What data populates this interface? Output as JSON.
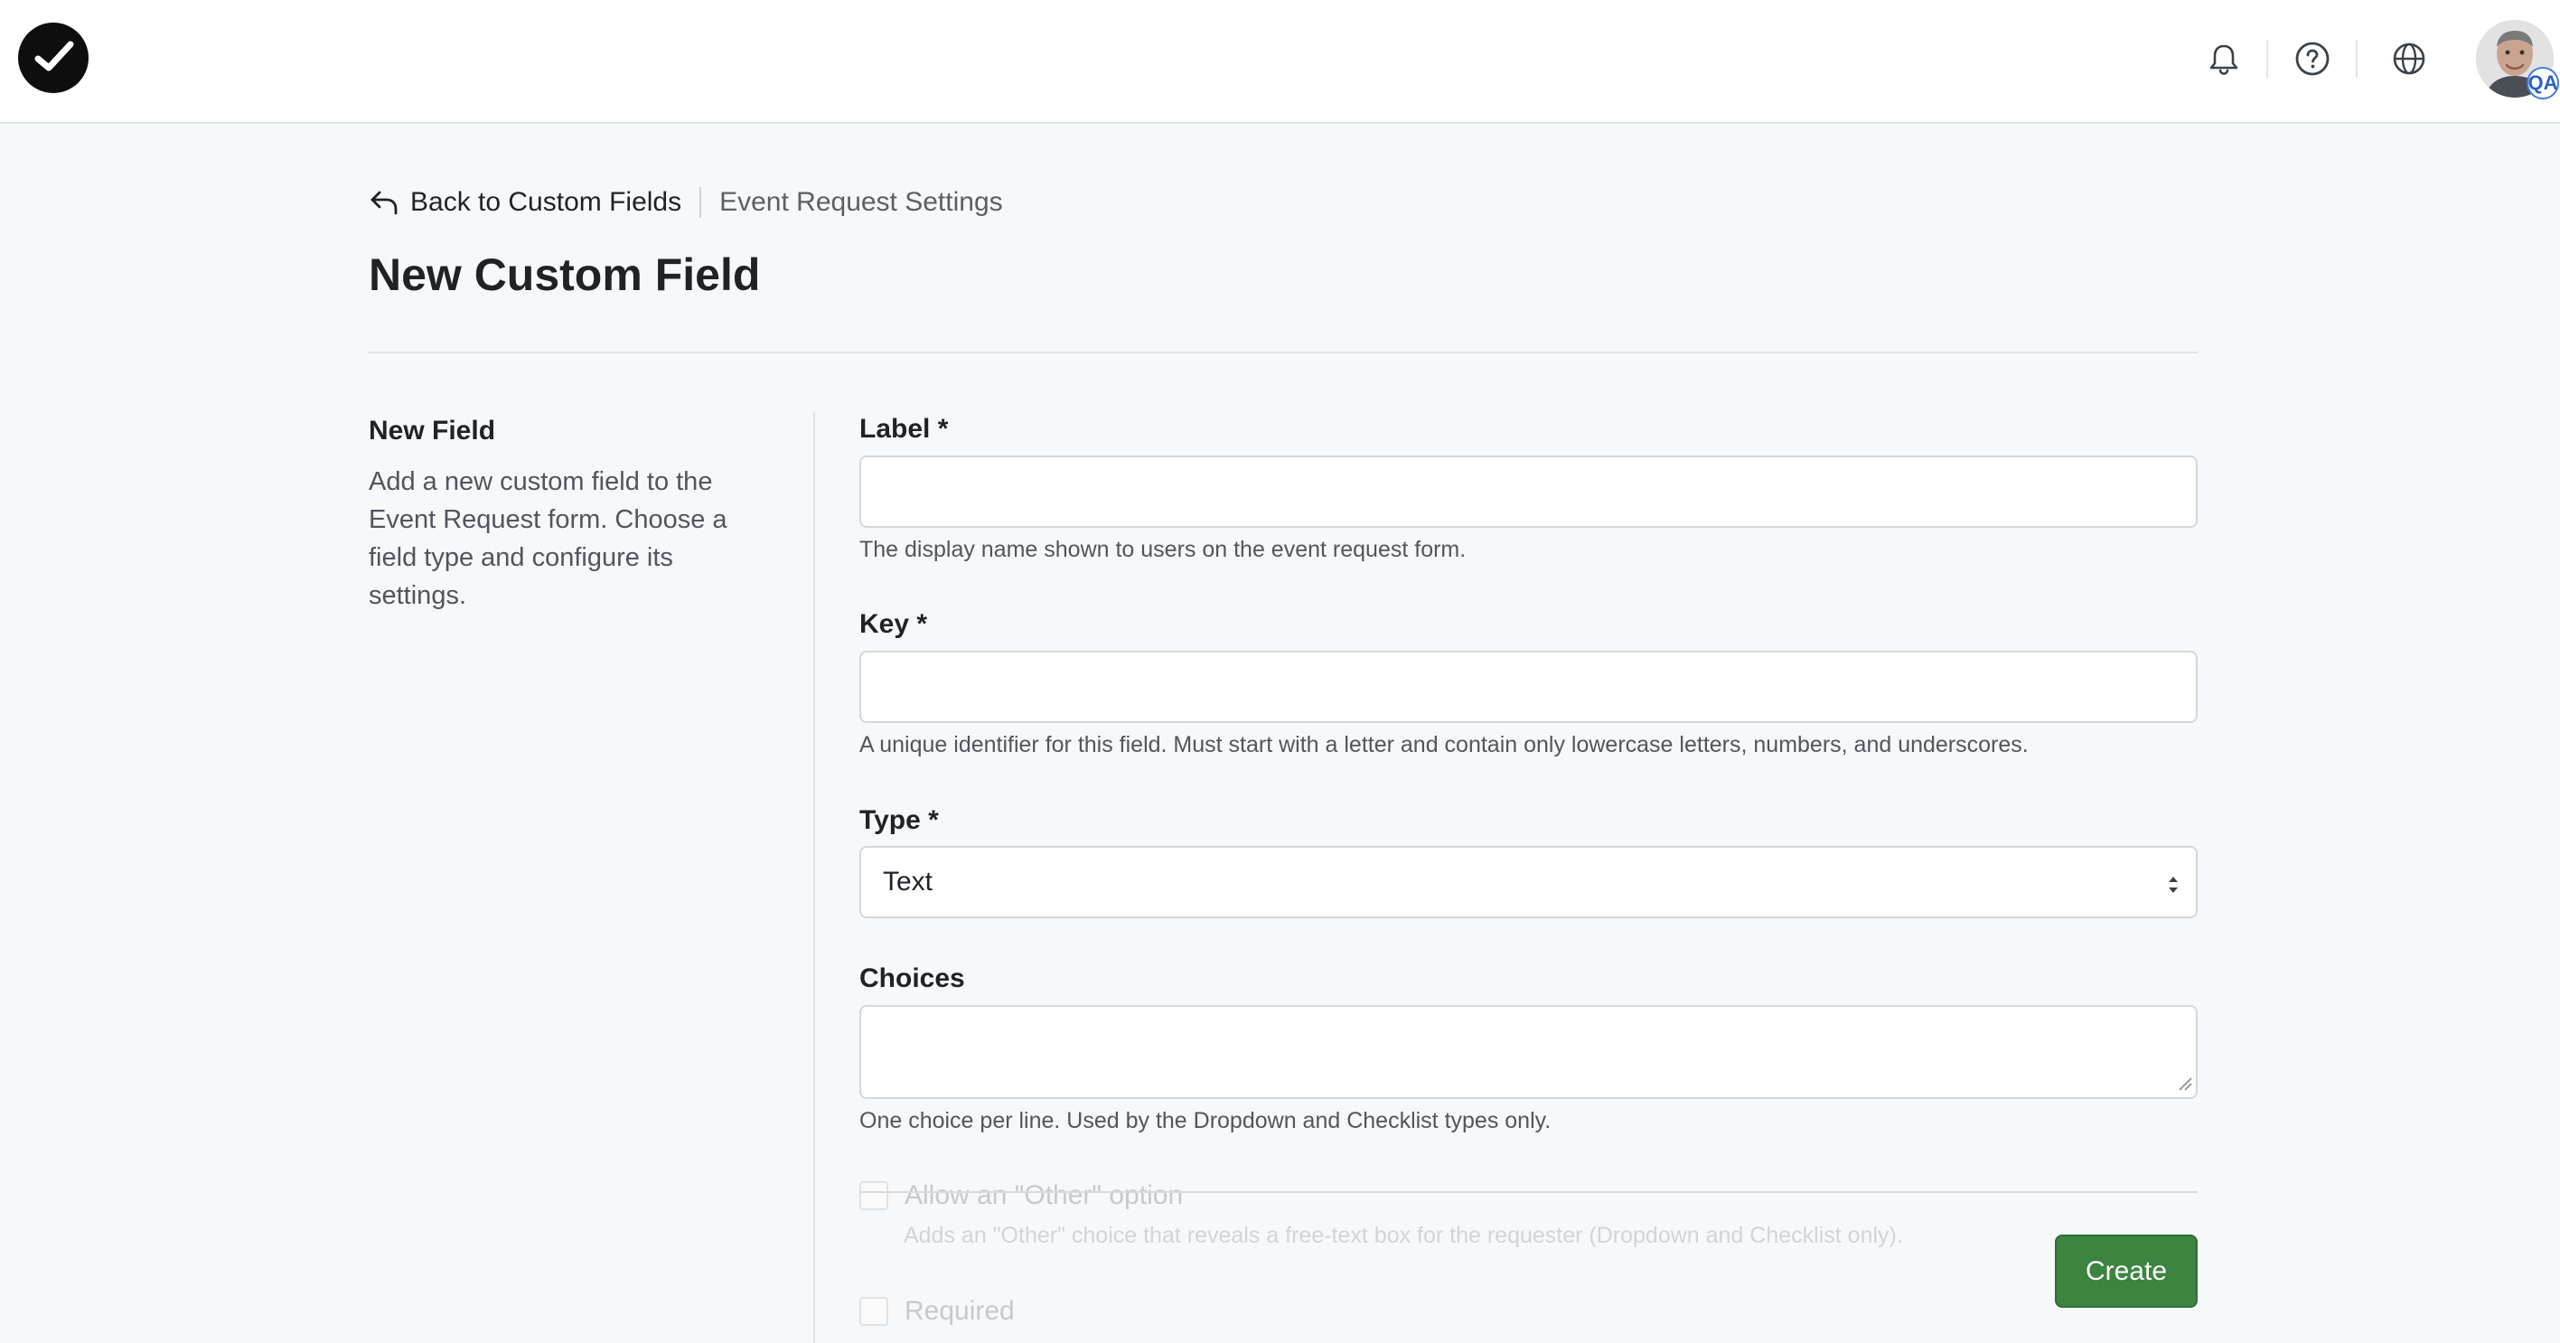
{
  "header": {
    "logo": "checkmark-logo-icon",
    "icons": [
      "bell-icon",
      "help-circle-icon",
      "globe-icon"
    ],
    "avatar_badge": "QA"
  },
  "breadcrumb": {
    "back_label": "Back to Custom Fields",
    "current": "Event Request Settings"
  },
  "page": {
    "title": "New Custom Field"
  },
  "sidebar": {
    "title": "New Field",
    "description": "Add a new custom field to the Event Request form. Choose a field type and configure its settings."
  },
  "form": {
    "label_field": {
      "label": "Label *",
      "value": "",
      "help": "The display name shown to users on the event request form."
    },
    "key_field": {
      "label": "Key *",
      "value": "",
      "help": "A unique identifier for this field. Must start with a letter and contain only lowercase letters, numbers, and underscores."
    },
    "type_field": {
      "label": "Type *",
      "selected": "Text"
    },
    "choices_field": {
      "label": "Choices",
      "value": "",
      "help": "One choice per line. Used by the Dropdown and Checklist types only."
    },
    "allow_other": {
      "label": "Allow an \"Other\" option",
      "help": "Adds an \"Other\" choice that reveals a free-text box for the requester (Dropdown and Checklist only)."
    },
    "required": {
      "label": "Required"
    },
    "submit_label": "Create"
  },
  "colors": {
    "primary_button": "#3c8440",
    "background": "#f7f8f9",
    "header_background": "#ffffff"
  }
}
